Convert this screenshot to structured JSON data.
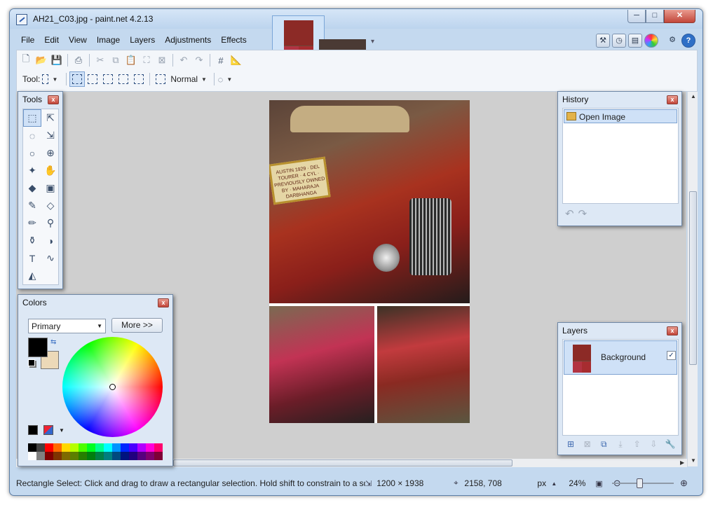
{
  "window": {
    "title": "AH21_C03.jpg - paint.net 4.2.13",
    "minimize": "─",
    "maximize": "□",
    "close": "✕"
  },
  "menu": [
    "File",
    "Edit",
    "View",
    "Image",
    "Layers",
    "Adjustments",
    "Effects"
  ],
  "toolbar": {
    "tool_label": "Tool:",
    "blend_mode": "Normal"
  },
  "tools_panel": {
    "title": "Tools",
    "close": "x",
    "tools": [
      {
        "name": "rectangle-select-tool-icon",
        "glyph": "⬚",
        "active": true
      },
      {
        "name": "move-selected-pixels-tool-icon",
        "glyph": "⇱"
      },
      {
        "name": "lasso-select-tool-icon",
        "glyph": "◌"
      },
      {
        "name": "move-selection-tool-icon",
        "glyph": "⇲"
      },
      {
        "name": "ellipse-select-tool-icon",
        "glyph": "○"
      },
      {
        "name": "zoom-tool-icon",
        "glyph": "⊕"
      },
      {
        "name": "magic-wand-tool-icon",
        "glyph": "✦"
      },
      {
        "name": "pan-tool-icon",
        "glyph": "✋"
      },
      {
        "name": "paint-bucket-tool-icon",
        "glyph": "◆"
      },
      {
        "name": "gradient-tool-icon",
        "glyph": "▣"
      },
      {
        "name": "paintbrush-tool-icon",
        "glyph": "✎"
      },
      {
        "name": "eraser-tool-icon",
        "glyph": "◇"
      },
      {
        "name": "pencil-tool-icon",
        "glyph": "✏"
      },
      {
        "name": "color-picker-tool-icon",
        "glyph": "⚲"
      },
      {
        "name": "clone-stamp-tool-icon",
        "glyph": "⚱"
      },
      {
        "name": "recolor-tool-icon",
        "glyph": "◑"
      },
      {
        "name": "text-tool-icon",
        "glyph": "T"
      },
      {
        "name": "line-curve-tool-icon",
        "glyph": "∿"
      },
      {
        "name": "shapes-tool-icon",
        "glyph": "◭"
      }
    ]
  },
  "colors_panel": {
    "title": "Colors",
    "close": "x",
    "mode": "Primary",
    "more_label": "More >>",
    "primary_color": "#000000",
    "secondary_color": "#ecd9b8",
    "palette": [
      "#000000",
      "#404040",
      "#ff0000",
      "#ff6a00",
      "#ffd800",
      "#b6ff00",
      "#4cff00",
      "#00ff21",
      "#00ff90",
      "#00ffff",
      "#0094ff",
      "#0026ff",
      "#4800ff",
      "#b200ff",
      "#ff00dc",
      "#ff006e",
      "#ffffff",
      "#808080",
      "#7f0000",
      "#7f3300",
      "#7f6a00",
      "#5b7f00",
      "#267f00",
      "#007f0e",
      "#007f46",
      "#007f7f",
      "#004a7f",
      "#00137f",
      "#21007f",
      "#57007f",
      "#7f006e",
      "#7f0037"
    ]
  },
  "history_panel": {
    "title": "History",
    "close": "x",
    "items": [
      "Open Image"
    ],
    "undo": "↶",
    "redo": "↷"
  },
  "layers_panel": {
    "title": "Layers",
    "close": "x",
    "layers": [
      {
        "name": "Background",
        "visible": "✓"
      }
    ]
  },
  "image_sign_text": "AUSTIN 1929 · DEL TOURER · 4 CYL · PREVIOUSLY OWNED BY · MAHARAJA DARBHANGA",
  "status": {
    "message": "Rectangle Select: Click and drag to draw a rectangular selection. Hold shift to constrain to a square.",
    "image_size": "1200 × 1938",
    "cursor": "2158, 708",
    "units": "px",
    "zoom": "24%"
  }
}
